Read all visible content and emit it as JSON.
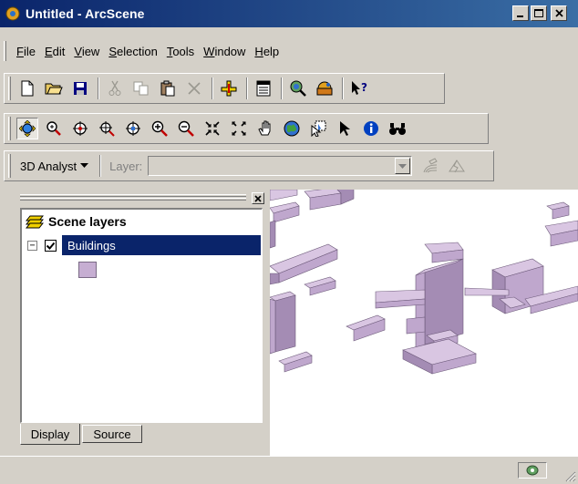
{
  "window": {
    "title": "Untitled - ArcScene",
    "buttons": {
      "minimize": "_",
      "maximize": "□",
      "close": "✕"
    }
  },
  "menubar": {
    "items": [
      {
        "u": "F",
        "rest": "ile"
      },
      {
        "u": "E",
        "rest": "dit"
      },
      {
        "u": "V",
        "rest": "iew"
      },
      {
        "u": "S",
        "rest": "election"
      },
      {
        "u": "T",
        "rest": "ools"
      },
      {
        "u": "W",
        "rest": "indow"
      },
      {
        "u": "H",
        "rest": "elp"
      }
    ]
  },
  "toolbar_standard": {
    "icons": [
      "new-document-icon",
      "open-folder-icon",
      "save-icon",
      "cut-icon",
      "copy-icon",
      "paste-icon",
      "delete-icon",
      "add-data-icon",
      "scene-properties-icon",
      "zoom-to-layer-icon",
      "arc-toolbox-icon",
      "whats-this-icon"
    ]
  },
  "toolbar_tools": {
    "icons": [
      "navigate-icon",
      "zoom-in-out-icon",
      "pan-target-icon",
      "narrow-target-icon",
      "center-target-icon",
      "zoom-in-icon",
      "zoom-out-icon",
      "fixed-zoom-in-icon",
      "fixed-zoom-out-icon",
      "pan-hand-icon",
      "full-extent-icon",
      "select-features-icon",
      "select-elements-icon",
      "identify-icon",
      "find-icon"
    ]
  },
  "toolbar_3d": {
    "analyst_label": "3D Analyst",
    "layer_label": "Layer:",
    "layer_value": ""
  },
  "toc": {
    "root_label": "Scene layers",
    "layers": [
      {
        "name": "Buildings",
        "checked": true,
        "expanded": true,
        "symbol_color": "#c6aed2"
      }
    ],
    "tabs": {
      "display": "Display",
      "source": "Source"
    }
  },
  "colors": {
    "titlebar": "#0a246a",
    "building_top": "#d9c6e2",
    "building_side": "#a48cb4",
    "building_front": "#bfa7cd",
    "selection": "#0a246a"
  }
}
